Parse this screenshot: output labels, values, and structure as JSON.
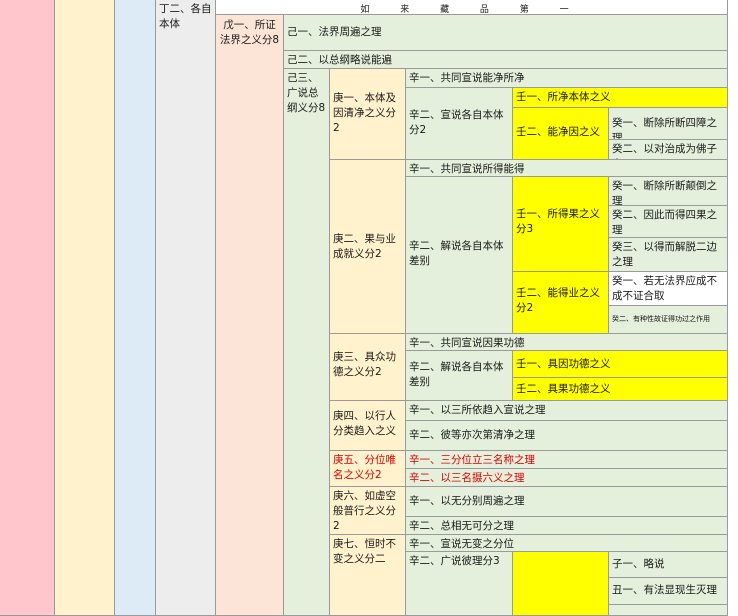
{
  "colors": {
    "pink": "#ffc6cc",
    "cream": "#fff2cc",
    "blue": "#ddebf7",
    "grey": "#ededed",
    "peach": "#fce4d6",
    "green": "#e4efdc",
    "yellow": "#ffff00",
    "red_text": "#e00000"
  },
  "header": {
    "title": "如 来 藏 品 第 一"
  },
  "col_ding": "丁二、各自本体",
  "col_wu": "戊一、所证法界之义分8",
  "ji": {
    "ji1": "己一、法界周遍之理",
    "ji2": "己二、以总纲略说能遍",
    "ji3": "己三、广说总纲义分8"
  },
  "geng": {
    "g1": "庚一、本体及因清净之义分2",
    "g2": "庚二、果与业成就义分2",
    "g3": "庚三、具众功德之义分2",
    "g4": "庚四、以行人分类趋入之义",
    "g5": "庚五、分位唯名之义分2",
    "g6": "庚六、如虚空般普行之义分2",
    "g7": "庚七、恒时不变之义分二"
  },
  "xin": {
    "r1": "辛一、共同宣说能净所净",
    "r2": "辛二、宣说各自本体分2",
    "r3": "辛一、共同宣说所得能得",
    "r4": "辛二、解说各自本体差别",
    "r5": "辛一、共同宣说因果功德",
    "r6": "辛二、解说各自本体差别",
    "r7": "辛一、以三所依趋入宣说之理",
    "r8": "辛二、彼等亦次第清净之理",
    "r9": "辛一、三分位立三名称之理",
    "r10": "辛二、以三名摄六义之理",
    "r11": "辛一、以无分别周遍之理",
    "r12": "辛二、总相无可分之理",
    "r13": "辛一、宣说无变之分位",
    "r14": "辛二、广说彼理分3"
  },
  "ren": {
    "a": "壬一、所净本体之义",
    "b": "壬二、能净因之义",
    "c": "壬一、所得果之义分3",
    "d": "壬二、能得业之义分2",
    "e": "壬一、具因功德之义",
    "f": "壬二、具果功德之义"
  },
  "gui": {
    "a": "癸一、断除所断四障之理",
    "b": "癸二、以对治成为佛子之",
    "c": "癸一、断除所断颠倒之理",
    "d": "癸二、因此而得四果之理",
    "e": "癸三、以得而解脱二边之理",
    "f": "癸一、若无法界应成不成不证合取",
    "g": "癸二、有种性故证得功过之作用"
  },
  "zi": {
    "a": "子一、略说",
    "b": "丑一、有法显现生灭理"
  }
}
